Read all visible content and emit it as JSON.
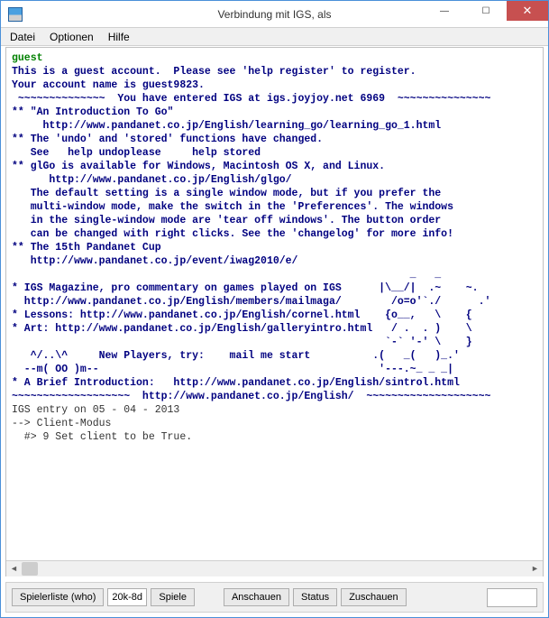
{
  "window": {
    "title": "Verbindung mit IGS, als"
  },
  "menu": {
    "file": "Datei",
    "options": "Optionen",
    "help": "Hilfe"
  },
  "terminal": {
    "guest": "guest",
    "l1": "This is a guest account.  Please see 'help register' to register.",
    "l2": "Your account name is guest9823.",
    "l3": " ~~~~~~~~~~~~~~  You have entered IGS at igs.joyjoy.net 6969  ~~~~~~~~~~~~~~~",
    "l4": "** \"An Introduction To Go\"",
    "l5": "     http://www.pandanet.co.jp/English/learning_go/learning_go_1.html",
    "l6": "** The 'undo' and 'stored' functions have changed.",
    "l7": "   See   help undoplease     help stored",
    "l8": "** glGo is available for Windows, Macintosh OS X, and Linux.",
    "l9": "      http://www.pandanet.co.jp/English/glgo/",
    "l10": "   The default setting is a single window mode, but if you prefer the",
    "l11": "   multi-window mode, make the switch in the 'Preferences'. The windows",
    "l12": "   in the single-window mode are 'tear off windows'. The button order",
    "l13": "   can be changed with right clicks. See the 'changelog' for more info!",
    "l14": "** The 15th Pandanet Cup",
    "l15": "   http://www.pandanet.co.jp/event/iwag2010/e/",
    "l16": "                                                                _   _",
    "l17": "* IGS Magazine, pro commentary on games played on IGS      |\\__/|  .~    ~.",
    "l18": "  http://www.pandanet.co.jp/English/members/mailmaga/        /o=o'`./      .'",
    "l19": "* Lessons: http://www.pandanet.co.jp/English/cornel.html    {o__,   \\    {",
    "l20": "* Art: http://www.pandanet.co.jp/English/galleryintro.html   / .  . )    \\",
    "l21": "                                                            `-` '-' \\    }",
    "l22": "   ^/..\\^     New Players, try:    mail me start          .(   _(   )_.'",
    "l23": "  --m( OO )m--                                             '---.~_ _ _|",
    "l24": "* A Brief Introduction:   http://www.pandanet.co.jp/English/sintrol.html",
    "l25": "~~~~~~~~~~~~~~~~~~~  http://www.pandanet.co.jp/English/  ~~~~~~~~~~~~~~~~~~~~",
    "l26": "IGS entry on 05 - 04 - 2013",
    "l27": "--> Client-Modus",
    "l28": "  #> 9 Set client to be True."
  },
  "bottom": {
    "players": "Spielerliste (who)",
    "rank": "20k-8d",
    "games": "Spiele",
    "observe": "Anschauen",
    "status": "Status",
    "watch": "Zuschauen"
  }
}
